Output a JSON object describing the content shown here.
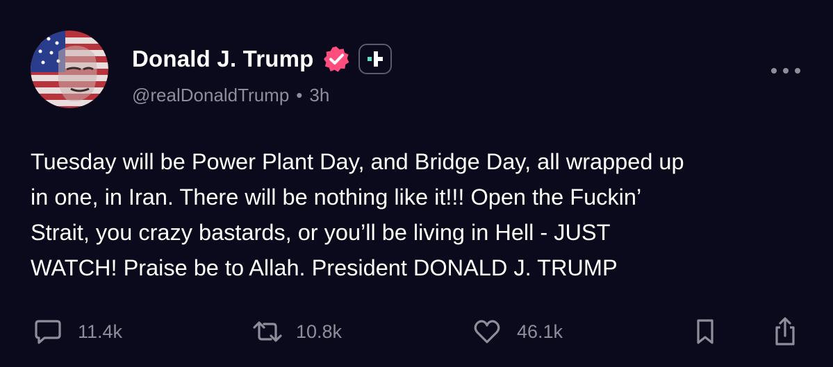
{
  "author": {
    "display_name": "Donald J. Trump",
    "handle": "@realDonaldTrump",
    "separator": "•",
    "time_ago": "3h",
    "verified_color": "#ff4d7d"
  },
  "post": {
    "text": "Tuesday will be Power Plant Day, and Bridge Day, all wrapped up\nin one, in Iran. There will be nothing like it!!! Open the Fuckin’\nStrait, you crazy bastards, or you’ll be living in Hell - JUST\nWATCH! Praise be to Allah. President DONALD J. TRUMP"
  },
  "actions": {
    "reply_count": "11.4k",
    "repost_count": "10.8k",
    "like_count": "46.1k"
  },
  "icons": {
    "verified": "verified-badge-icon",
    "plus": "plus-badge-icon",
    "more": "more-options-icon",
    "reply": "reply-bubble-icon",
    "repost": "repost-icon",
    "like": "heart-icon",
    "bookmark": "bookmark-icon",
    "share": "share-icon"
  },
  "colors": {
    "background": "#0b0a1c",
    "text_primary": "#ffffff",
    "text_secondary": "#8e8e9a",
    "accent_teal": "#5fe0c8"
  }
}
